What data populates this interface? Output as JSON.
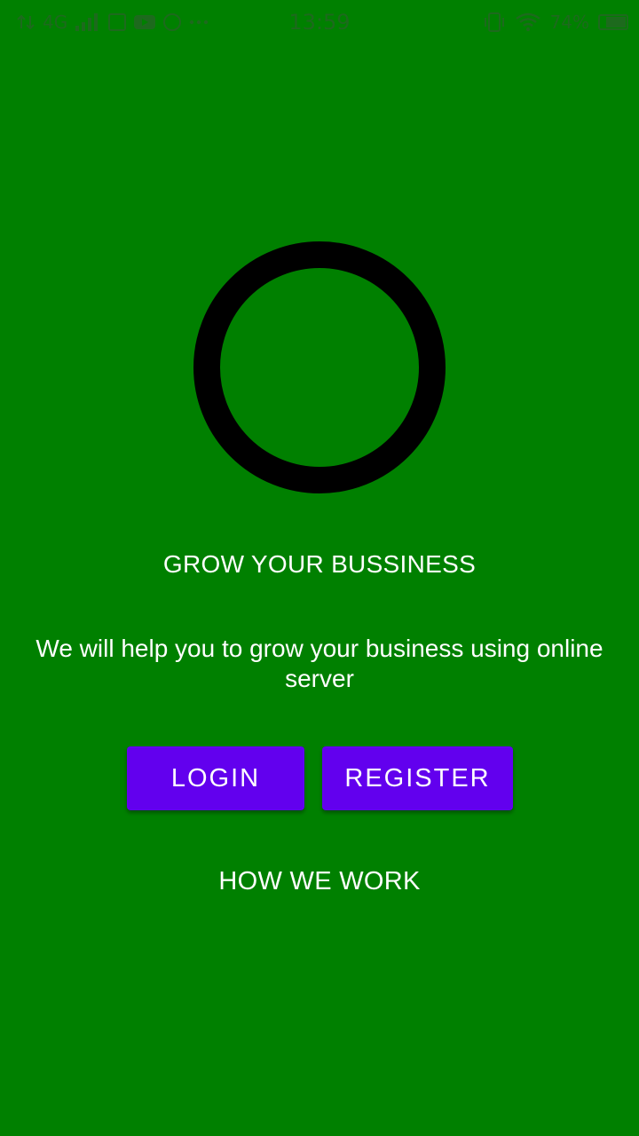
{
  "status_bar": {
    "network": "4G",
    "time": "13:59",
    "battery": "74%",
    "battery_level": 0.74,
    "left_icons": [
      "data-arrows-icon",
      "signal-icon",
      "sim-icon",
      "youtube-icon",
      "messenger-icon",
      "more-dots-icon"
    ],
    "right_icons": [
      "vibrate-icon",
      "wifi-icon",
      "battery-icon"
    ],
    "color": "#1d6a1d"
  },
  "colors": {
    "background": "#008000",
    "ring": "#000000",
    "button": "#6200ee",
    "text": "#ffffff"
  },
  "main": {
    "headline": "GROW YOUR BUSSINESS",
    "description": "We will help you to grow your business using online server",
    "login_label": "LOGIN",
    "register_label": "REGISTER",
    "how_we_work_label": "HOW WE WORK"
  }
}
